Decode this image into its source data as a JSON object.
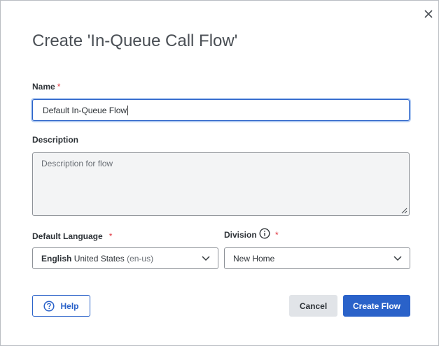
{
  "dialog": {
    "title": "Create 'In-Queue Call Flow'",
    "close_icon": "close-icon"
  },
  "form": {
    "name": {
      "label": "Name",
      "required_marker": "*",
      "value": "Default In-Queue Flow"
    },
    "description": {
      "label": "Description",
      "placeholder": "Description for flow",
      "value": ""
    },
    "default_language": {
      "label": "Default Language",
      "required_marker": "*",
      "selected_bold": "English",
      "selected_rest": "United States",
      "selected_code": "(en-us)"
    },
    "division": {
      "label": "Division",
      "required_marker": "*",
      "info_icon": "info-circle-icon",
      "selected": "New Home"
    }
  },
  "buttons": {
    "help_label": "Help",
    "cancel_label": "Cancel",
    "create_label": "Create Flow"
  },
  "colors": {
    "primary": "#2a62c9",
    "required": "#e0353f",
    "secondary_button_bg": "#e1e4e8"
  }
}
